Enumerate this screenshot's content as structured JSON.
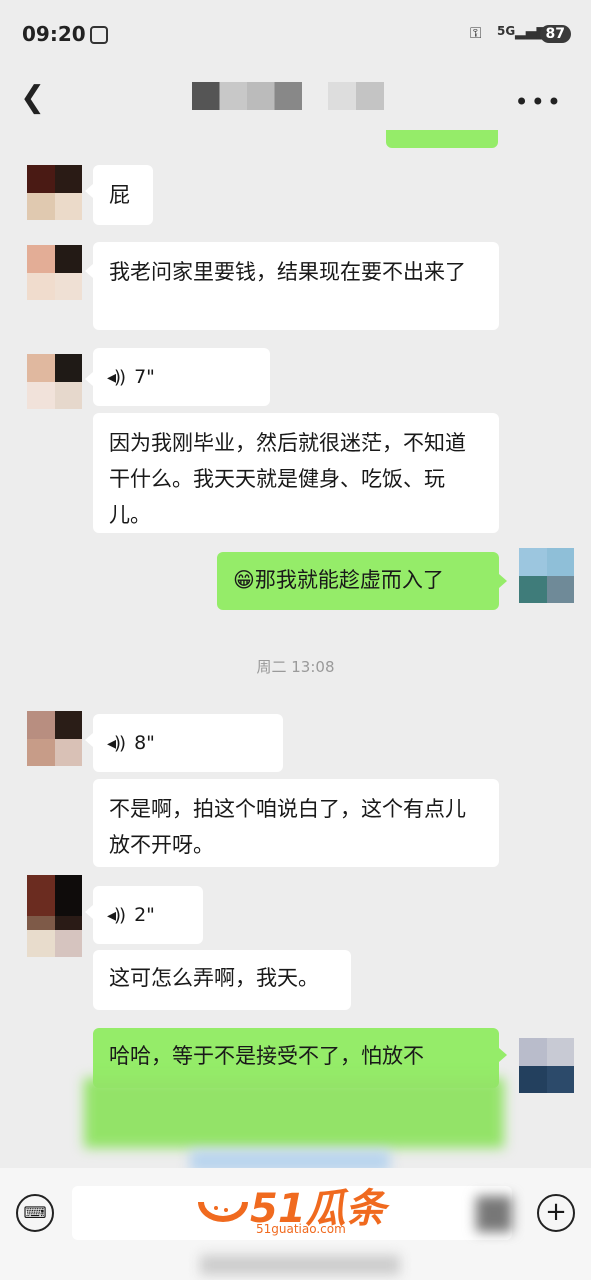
{
  "status_bar": {
    "time": "09:20",
    "network": "5G",
    "battery": "87"
  },
  "nav": {
    "back_icon": "chevron-left-icon",
    "more_icon": "more-icon"
  },
  "messages": [
    {
      "side": "left",
      "type": "text",
      "text": "屁"
    },
    {
      "side": "left",
      "type": "text",
      "text": "我老问家里要钱，结果现在要不出来了"
    },
    {
      "side": "left",
      "type": "voice",
      "duration": "7\""
    },
    {
      "side": "left",
      "type": "text",
      "text": "因为我刚毕业，然后就很迷茫，不知道干什么。我天天就是健身、吃饭、玩儿。"
    },
    {
      "side": "right",
      "type": "text",
      "emoji": "😁",
      "text": "那我就能趁虚而入了"
    },
    {
      "type": "timestamp",
      "text": "周二 13:08"
    },
    {
      "side": "left",
      "type": "voice",
      "duration": "8\""
    },
    {
      "side": "left",
      "type": "text",
      "text": "不是啊，拍这个咱说白了，这个有点儿放不开呀。"
    },
    {
      "side": "left",
      "type": "voice",
      "duration": "2\""
    },
    {
      "side": "left",
      "type": "text",
      "text": "这可怎么弄啊，我天。"
    },
    {
      "side": "right",
      "type": "text",
      "text": "哈哈，等于不是接受不了，怕放不"
    }
  ],
  "watermark": {
    "logo": "51瓜条",
    "url": "51guatiao.com"
  },
  "input_bar": {
    "keyboard_icon": "keyboard-icon",
    "plus_icon": "plus-icon"
  }
}
